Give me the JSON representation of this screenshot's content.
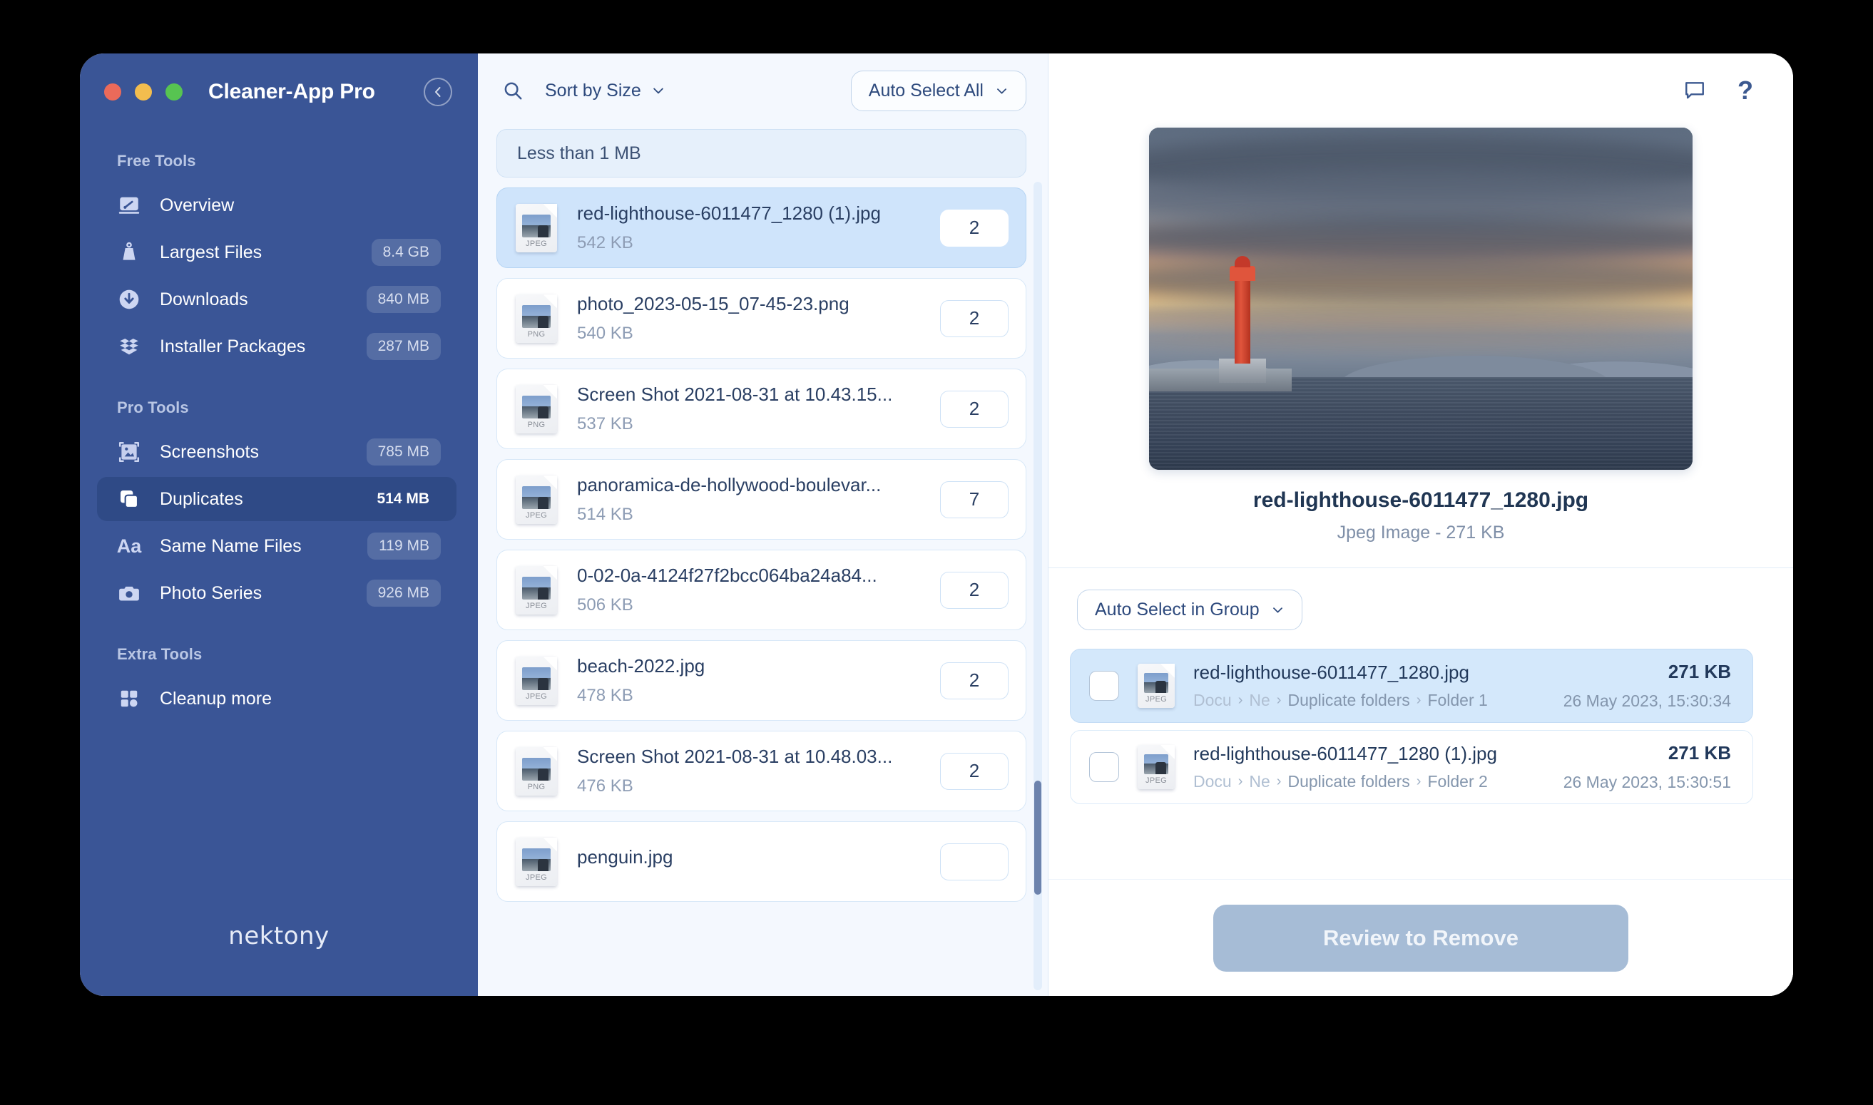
{
  "window": {
    "app_title": "Cleaner-App Pro",
    "traffic_lights": [
      "close-button",
      "minimize-button",
      "zoom-button"
    ],
    "collapse_icon": "chevron-left-circle-icon"
  },
  "sidebar": {
    "sections": [
      {
        "label": "Free Tools",
        "items": [
          {
            "label": "Overview",
            "badge": "",
            "icon": "dashboard-icon",
            "active": false
          },
          {
            "label": "Largest Files",
            "badge": "8.4 GB",
            "icon": "weight-icon",
            "active": false
          },
          {
            "label": "Downloads",
            "badge": "840 MB",
            "icon": "download-circle-icon",
            "active": false
          },
          {
            "label": "Installer Packages",
            "badge": "287 MB",
            "icon": "package-icon",
            "active": false
          }
        ]
      },
      {
        "label": "Pro Tools",
        "items": [
          {
            "label": "Screenshots",
            "badge": "785 MB",
            "icon": "image-frame-icon",
            "active": false
          },
          {
            "label": "Duplicates",
            "badge": "514 MB",
            "icon": "copy-icon",
            "active": true
          },
          {
            "label": "Same Name Files",
            "badge": "119 MB",
            "icon": "aa-text-icon",
            "active": false
          },
          {
            "label": "Photo Series",
            "badge": "926 MB",
            "icon": "camera-icon",
            "active": false
          }
        ]
      },
      {
        "label": "Extra Tools",
        "items": [
          {
            "label": "Cleanup more",
            "badge": "",
            "icon": "grid-squares-icon",
            "active": false
          }
        ]
      }
    ],
    "brand": "nektony"
  },
  "middle": {
    "search_icon": "search-icon",
    "sort_label": "Sort by Size",
    "auto_select_label": "Auto Select All",
    "group_header": "Less than 1 MB",
    "files": [
      {
        "name": "red-lighthouse-6011477_1280 (1).jpg",
        "size": "542 KB",
        "count": "2",
        "ext": "JPEG",
        "selected": true
      },
      {
        "name": "photo_2023-05-15_07-45-23.png",
        "size": "540 KB",
        "count": "2",
        "ext": "PNG",
        "selected": false
      },
      {
        "name": "Screen Shot 2021-08-31 at 10.43.15...",
        "size": "537 KB",
        "count": "2",
        "ext": "PNG",
        "selected": false
      },
      {
        "name": "panoramica-de-hollywood-boulevar...",
        "size": "514 KB",
        "count": "7",
        "ext": "JPEG",
        "selected": false
      },
      {
        "name": "0-02-0a-4124f27f2bcc064ba24a84...",
        "size": "506 KB",
        "count": "2",
        "ext": "JPEG",
        "selected": false
      },
      {
        "name": "beach-2022.jpg",
        "size": "478 KB",
        "count": "2",
        "ext": "JPEG",
        "selected": false
      },
      {
        "name": "Screen Shot 2021-08-31 at 10.48.03...",
        "size": "476 KB",
        "count": "2",
        "ext": "PNG",
        "selected": false
      },
      {
        "name": "penguin.jpg",
        "size": "",
        "count": "",
        "ext": "JPEG",
        "selected": false
      }
    ]
  },
  "right": {
    "comment_icon": "comment-bubble-icon",
    "help_icon": "?",
    "preview": {
      "image_alt": "red-lighthouse-photo",
      "title": "red-lighthouse-6011477_1280.jpg",
      "subtitle": "Jpeg Image - 271 KB"
    },
    "auto_select_group_label": "Auto Select in Group",
    "duplicates": [
      {
        "name": "red-lighthouse-6011477_1280.jpg",
        "path": [
          "Docu",
          "Ne",
          "Duplicate folders",
          "Folder 1"
        ],
        "size": "271 KB",
        "date": "26 May 2023, 15:30:34",
        "ext": "JPEG",
        "checked": false,
        "selected": true
      },
      {
        "name": "red-lighthouse-6011477_1280 (1).jpg",
        "path": [
          "Docu",
          "Ne",
          "Duplicate folders",
          "Folder 2"
        ],
        "size": "271 KB",
        "date": "26 May 2023, 15:30:51",
        "ext": "JPEG",
        "checked": false,
        "selected": false
      }
    ],
    "review_button": "Review to Remove"
  },
  "colors": {
    "sidebar_bg": "#3a5596",
    "sidebar_active": "#2f4a86",
    "accent_text": "#2e4a7d",
    "middle_bg": "#f4f8fe",
    "selected_row": "#cfe4fb",
    "review_button": "#a6bcd6"
  }
}
